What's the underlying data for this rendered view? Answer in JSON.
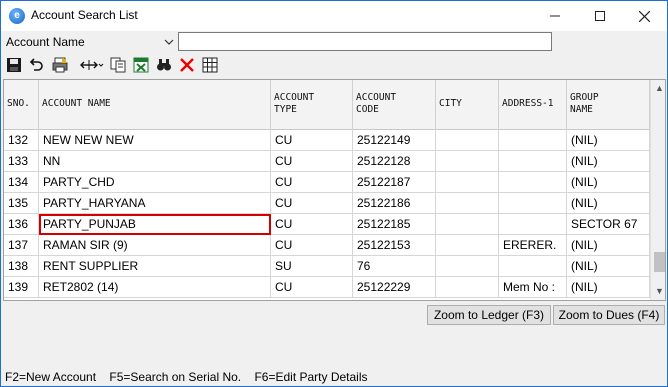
{
  "window": {
    "title": "Account Search List"
  },
  "search": {
    "field_label": "Account Name",
    "query": ""
  },
  "toolbar": {
    "icons": [
      "save-icon",
      "undo-icon",
      "print-icon",
      "column-width-icon",
      "copy-icon",
      "excel-icon",
      "find-icon",
      "delete-icon",
      "grid-icon"
    ]
  },
  "grid": {
    "headers": {
      "sno": "SNO.",
      "name": "ACCOUNT NAME",
      "type_1": "ACCOUNT",
      "type_2": "TYPE",
      "code_1": "ACCOUNT",
      "code_2": "CODE",
      "city": "CITY",
      "address": "ADDRESS-1",
      "group_1": "GROUP",
      "group_2": "NAME"
    },
    "rows": [
      {
        "sno": "132",
        "name": "NEW NEW NEW",
        "type": "CU",
        "code": "25122149",
        "city": "",
        "address": "",
        "group": "(NIL)"
      },
      {
        "sno": "133",
        "name": "NN",
        "type": "CU",
        "code": "25122128",
        "city": "",
        "address": "",
        "group": "(NIL)"
      },
      {
        "sno": "134",
        "name": "PARTY_CHD",
        "type": "CU",
        "code": "25122187",
        "city": "",
        "address": "",
        "group": "(NIL)"
      },
      {
        "sno": "135",
        "name": "PARTY_HARYANA",
        "type": "CU",
        "code": "25122186",
        "city": "",
        "address": "",
        "group": "(NIL)"
      },
      {
        "sno": "136",
        "name": "PARTY_PUNJAB",
        "type": "CU",
        "code": "25122185",
        "city": "",
        "address": "",
        "group": "SECTOR 67"
      },
      {
        "sno": "137",
        "name": "RAMAN SIR  (9)",
        "type": "CU",
        "code": "25122153",
        "city": "",
        "address": "ERERER.",
        "group": "(NIL)"
      },
      {
        "sno": "138",
        "name": "RENT SUPPLIER",
        "type": "SU",
        "code": "76",
        "city": "",
        "address": "",
        "group": "(NIL)"
      },
      {
        "sno": "139",
        "name": "RET2802  (14)",
        "type": "CU",
        "code": "25122229",
        "city": "",
        "address": "Mem No :",
        "group": "(NIL)"
      }
    ],
    "selected_row": "136"
  },
  "buttons": {
    "zoom_ledger": "Zoom to Ledger (F3)",
    "zoom_dues": "Zoom to Dues (F4)"
  },
  "status": {
    "hints": "F2=New Account    F5=Search on Serial No.    F6=Edit Party Details"
  },
  "colors": {
    "selection_border": "#d40000",
    "window_border": "#1e6fd0"
  }
}
